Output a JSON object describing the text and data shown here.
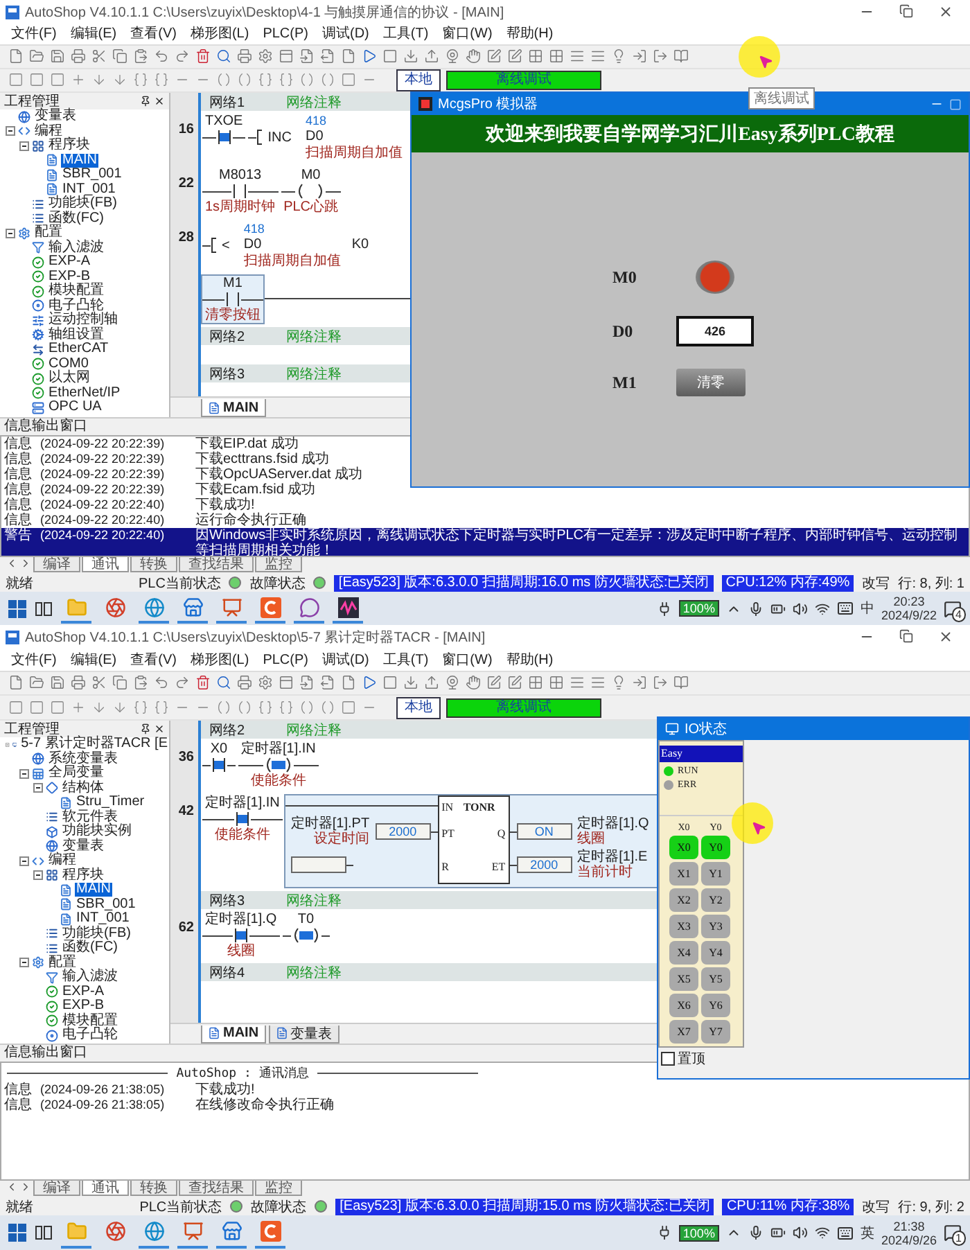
{
  "screens": [
    {
      "title": "AutoShop V4.10.1.1  C:\\Users\\zuyix\\Desktop\\4-1 与触摸屏通信的协议 - [MAIN]",
      "menu": [
        "文件(F)",
        "编辑(E)",
        "查看(V)",
        "梯形图(L)",
        "PLC(P)",
        "调试(D)",
        "工具(T)",
        "窗口(W)",
        "帮助(H)"
      ],
      "mode_button": "本地",
      "debug_status": "离线调试",
      "tooltip": "离线调试",
      "cursor": {
        "kind": "toolbar"
      },
      "project_panel": {
        "title": "工程管理",
        "tree": [
          {
            "label": "变量表",
            "kind": "globe",
            "selected": false
          },
          {
            "label": "编程",
            "kind": "code",
            "selected": false,
            "children": [
              {
                "label": "程序块",
                "kind": "blocks",
                "selected": false,
                "children": [
                  {
                    "label": "MAIN",
                    "kind": "page",
                    "selected": true
                  },
                  {
                    "label": "SBR_001",
                    "kind": "page",
                    "selected": false
                  },
                  {
                    "label": "INT_001",
                    "kind": "page",
                    "selected": false
                  }
                ]
              },
              {
                "label": "功能块(FB)",
                "kind": "list",
                "selected": false
              },
              {
                "label": "函数(FC)",
                "kind": "list",
                "selected": false
              }
            ]
          },
          {
            "label": "配置",
            "kind": "config",
            "selected": false,
            "children": [
              {
                "label": "输入滤波",
                "kind": "filter",
                "selected": false
              },
              {
                "label": "EXP-A",
                "kind": "check",
                "selected": false
              },
              {
                "label": "EXP-B",
                "kind": "check",
                "selected": false
              },
              {
                "label": "模块配置",
                "kind": "check",
                "selected": false
              },
              {
                "label": "电子凸轮",
                "kind": "cam",
                "selected": false
              },
              {
                "label": "运动控制轴",
                "kind": "axis",
                "selected": false
              },
              {
                "label": "轴组设置",
                "kind": "gear",
                "selected": false
              },
              {
                "label": "EtherCAT",
                "kind": "ethercat",
                "selected": false
              },
              {
                "label": "COM0",
                "kind": "check",
                "selected": false
              },
              {
                "label": "以太网",
                "kind": "check",
                "selected": false
              },
              {
                "label": "EtherNet/IP",
                "kind": "check",
                "selected": false
              },
              {
                "label": "OPC UA",
                "kind": "opc",
                "selected": false
              }
            ]
          }
        ]
      },
      "editor": {
        "networks": [
          {
            "label": "网络1",
            "comment": "网络注释",
            "rungs": [
              {
                "step": "16",
                "elements": [
                  {
                    "kind": "contact",
                    "operand": "TXOE",
                    "active": true,
                    "selected": false
                  },
                  {
                    "kind": "instr",
                    "op": "INC",
                    "selected": false,
                    "args": [
                      {
                        "value": "418",
                        "operand": "D0",
                        "comment": "扫描周期自加值"
                      }
                    ]
                  }
                ]
              },
              {
                "step": "22",
                "elements": [
                  {
                    "kind": "contact",
                    "operand": "M8013",
                    "comment": "1s周期时钟",
                    "active": false,
                    "selected": false
                  },
                  {
                    "kind": "coil",
                    "operand": "M0",
                    "comment": "PLC心跳",
                    "active": false,
                    "selected": false
                  }
                ]
              },
              {
                "step": "28",
                "elements": [
                  {
                    "kind": "instr",
                    "op": "<",
                    "selected": false,
                    "args": [
                      {
                        "value": "418",
                        "operand": "D0",
                        "comment": "扫描周期自加值"
                      },
                      {
                        "operand": "K0"
                      }
                    ]
                  }
                ]
              },
              {
                "elements": [
                  {
                    "kind": "contact",
                    "operand": "M1",
                    "comment": "清零按钮",
                    "active": false,
                    "selected": true
                  }
                ]
              }
            ]
          },
          {
            "label": "网络2",
            "comment": "网络注释"
          },
          {
            "label": "网络3",
            "comment": "网络注释"
          }
        ],
        "tabs": [
          {
            "label": "MAIN",
            "selected": true
          }
        ]
      },
      "output": {
        "title": "信息输出窗口",
        "lines": [
          {
            "level": "信息",
            "time": "(2024-09-22 20:22:39)",
            "message": "下载EIP.dat 成功",
            "selected": false
          },
          {
            "level": "信息",
            "time": "(2024-09-22 20:22:39)",
            "message": "下载ecttrans.fsid 成功",
            "selected": false
          },
          {
            "level": "信息",
            "time": "(2024-09-22 20:22:39)",
            "message": "下载OpcUAServer.dat 成功",
            "selected": false
          },
          {
            "level": "信息",
            "time": "(2024-09-22 20:22:39)",
            "message": "下载Ecam.fsid 成功",
            "selected": false
          },
          {
            "level": "信息",
            "time": "(2024-09-22 20:22:40)",
            "message": "下载成功!",
            "selected": false
          },
          {
            "level": "信息",
            "time": "(2024-09-22 20:22:40)",
            "message": "运行命令执行正确",
            "selected": false
          },
          {
            "level": "警告",
            "time": "(2024-09-22 20:22:40)",
            "message": "因Windows非实时系统原因，离线调试状态下定时器与实时PLC有一定差异：涉及定时中断子程序、内部时钟信号、运动控制等扫描周期相关功能！",
            "selected": true
          }
        ],
        "tabs": [
          {
            "label": "编译",
            "selected": false
          },
          {
            "label": "通讯",
            "selected": true
          },
          {
            "label": "转换",
            "selected": false
          },
          {
            "label": "查找结果",
            "selected": false
          },
          {
            "label": "监控",
            "selected": false
          }
        ]
      },
      "status_bar": {
        "ready": "就绪",
        "plc_state": {
          "label": "PLC当前状态",
          "on": true
        },
        "fault_state": {
          "label": "故障状态",
          "on": true
        },
        "info": "[Easy523] 版本:6.3.0.0 扫描周期:16.0 ms 防火墙状态:已关闭",
        "cpu": "CPU:12%  内存:49%",
        "mode": "改写",
        "position": "行:  8, 列:  1"
      },
      "taskbar": {
        "apps": [
          {
            "kind": "explorer",
            "running": true
          },
          {
            "kind": "tool",
            "running": false
          },
          {
            "kind": "edge",
            "running": true
          },
          {
            "kind": "store",
            "running": true
          },
          {
            "kind": "office",
            "running": true
          },
          {
            "kind": "autoshop",
            "running": true
          },
          {
            "kind": "chat",
            "running": true
          },
          {
            "kind": "sim",
            "running": true
          }
        ],
        "battery": "100%",
        "ime": "中",
        "time": "20:23",
        "date": "2024/9/22",
        "notifications": "4"
      },
      "window": {
        "kind": "simulator",
        "title": "McgsPro 模拟器",
        "banner": "欢迎来到我要自学网学习汇川Easy系列PLC教程",
        "rows": [
          {
            "label": "M0",
            "kind": "lamp",
            "on": true
          },
          {
            "label": "D0",
            "kind": "display",
            "value": "426"
          },
          {
            "label": "M1",
            "kind": "button",
            "text": "清零"
          }
        ]
      }
    },
    {
      "title": "AutoShop V4.10.1.1  C:\\Users\\zuyix\\Desktop\\5-7 累计定时器TACR - [MAIN]",
      "menu": [
        "文件(F)",
        "编辑(E)",
        "查看(V)",
        "梯形图(L)",
        "PLC(P)",
        "调试(D)",
        "工具(T)",
        "窗口(W)",
        "帮助(H)"
      ],
      "mode_button": "本地",
      "debug_status": "离线调试",
      "cursor": {
        "kind": "io"
      },
      "project_panel": {
        "title": "工程管理",
        "tree": [
          {
            "label": "5-7 累计定时器TACR [E",
            "kind": "pc",
            "selected": false,
            "children": [
              {
                "label": "系统变量表",
                "kind": "globe",
                "selected": false
              },
              {
                "label": "全局变量",
                "kind": "table",
                "selected": false,
                "children": [
                  {
                    "label": "结构体",
                    "kind": "struct",
                    "selected": false,
                    "children": [
                      {
                        "label": "Stru_Timer",
                        "kind": "page",
                        "selected": false
                      }
                    ]
                  },
                  {
                    "label": "软元件表",
                    "kind": "list",
                    "selected": false
                  },
                  {
                    "label": "功能块实例",
                    "kind": "box",
                    "selected": false
                  },
                  {
                    "label": "变量表",
                    "kind": "globe",
                    "selected": false
                  }
                ]
              },
              {
                "label": "编程",
                "kind": "code",
                "selected": false,
                "children": [
                  {
                    "label": "程序块",
                    "kind": "blocks",
                    "selected": false,
                    "children": [
                      {
                        "label": "MAIN",
                        "kind": "page",
                        "selected": true
                      },
                      {
                        "label": "SBR_001",
                        "kind": "page",
                        "selected": false
                      },
                      {
                        "label": "INT_001",
                        "kind": "page",
                        "selected": false
                      }
                    ]
                  },
                  {
                    "label": "功能块(FB)",
                    "kind": "list",
                    "selected": false
                  },
                  {
                    "label": "函数(FC)",
                    "kind": "list",
                    "selected": false
                  }
                ]
              },
              {
                "label": "配置",
                "kind": "config",
                "selected": false,
                "children": [
                  {
                    "label": "输入滤波",
                    "kind": "filter",
                    "selected": false
                  },
                  {
                    "label": "EXP-A",
                    "kind": "check",
                    "selected": false
                  },
                  {
                    "label": "EXP-B",
                    "kind": "check",
                    "selected": false
                  },
                  {
                    "label": "模块配置",
                    "kind": "check",
                    "selected": false
                  },
                  {
                    "label": "电子凸轮",
                    "kind": "cam",
                    "selected": false
                  }
                ]
              }
            ]
          }
        ]
      },
      "editor": {
        "networks": [
          {
            "label": "网络2",
            "comment": "网络注释",
            "rungs": [
              {
                "step": "36",
                "elements": [
                  {
                    "kind": "contact",
                    "operand": "X0",
                    "active": true,
                    "selected": false
                  },
                  {
                    "kind": "coil",
                    "operand": "定时器[1].IN",
                    "comment": "使能条件",
                    "active": true,
                    "selected": false
                  }
                ]
              },
              {
                "step": "42",
                "elements": [
                  {
                    "kind": "contact",
                    "operand": "定时器[1].IN",
                    "comment": "使能条件",
                    "active": true,
                    "selected": false
                  },
                  {
                    "kind": "block",
                    "type": "TONR",
                    "selected": true,
                    "inputs": [
                      {
                        "pin": "IN"
                      },
                      {
                        "pin": "PT",
                        "operand": "定时器[1].PT",
                        "value": "2000",
                        "comment": "设定时间"
                      },
                      {
                        "pin": "R"
                      }
                    ],
                    "outputs": [
                      {
                        "pin": "Q",
                        "value": "ON",
                        "operand": "定时器[1].Q",
                        "comment": "线圈"
                      },
                      {
                        "pin": "ET",
                        "value": "2000",
                        "operand": "定时器[1].E",
                        "comment": "当前计时"
                      }
                    ]
                  }
                ]
              }
            ]
          },
          {
            "label": "网络3",
            "comment": "网络注释",
            "rungs": [
              {
                "step": "62",
                "elements": [
                  {
                    "kind": "contact",
                    "operand": "定时器[1].Q",
                    "comment": "线圈",
                    "active": true,
                    "selected": false
                  },
                  {
                    "kind": "coil",
                    "operand": "T0",
                    "active": true,
                    "selected": false
                  }
                ]
              }
            ]
          },
          {
            "label": "网络4",
            "comment": "网络注释"
          }
        ],
        "tabs": [
          {
            "label": "MAIN",
            "selected": true
          },
          {
            "label": "变量表",
            "selected": false
          }
        ]
      },
      "output": {
        "title": "信息输出窗口",
        "header": "AutoShop : 通讯消息",
        "lines": [
          {
            "level": "信息",
            "time": "(2024-09-26 21:38:05)",
            "message": "下载成功!",
            "selected": false
          },
          {
            "level": "信息",
            "time": "(2024-09-26 21:38:05)",
            "message": "在线修改命令执行正确",
            "selected": false
          }
        ],
        "tabs": [
          {
            "label": "编译",
            "selected": false
          },
          {
            "label": "通讯",
            "selected": true
          },
          {
            "label": "转换",
            "selected": false
          },
          {
            "label": "查找结果",
            "selected": false
          },
          {
            "label": "监控",
            "selected": false
          }
        ]
      },
      "status_bar": {
        "ready": "就绪",
        "plc_state": {
          "label": "PLC当前状态",
          "on": true
        },
        "fault_state": {
          "label": "故障状态",
          "on": true
        },
        "info": "[Easy523] 版本:6.3.0.0 扫描周期:15.0 ms 防火墙状态:已关闭",
        "cpu": "CPU:11%  内存:38%",
        "mode": "改写",
        "position": "行:  9, 列:  2"
      },
      "taskbar": {
        "apps": [
          {
            "kind": "explorer",
            "running": true
          },
          {
            "kind": "tool",
            "running": false
          },
          {
            "kind": "edge",
            "running": true
          },
          {
            "kind": "office",
            "running": true
          },
          {
            "kind": "store",
            "running": true
          },
          {
            "kind": "autoshop",
            "running": true
          }
        ],
        "battery": "100%",
        "ime": "英",
        "time": "21:38",
        "date": "2024/9/26",
        "notifications": "1"
      },
      "window": {
        "kind": "io",
        "title": "IO状态",
        "device": "Easy",
        "leds": [
          {
            "label": "RUN",
            "on": true
          },
          {
            "label": "ERR",
            "on": false
          }
        ],
        "columns": [
          "X0",
          "Y0"
        ],
        "points": [
          [
            {
              "label": "X0",
              "on": true
            },
            {
              "label": "Y0",
              "on": true
            }
          ],
          [
            {
              "label": "X1",
              "on": false
            },
            {
              "label": "Y1",
              "on": false
            }
          ],
          [
            {
              "label": "X2",
              "on": false
            },
            {
              "label": "Y2",
              "on": false
            }
          ],
          [
            {
              "label": "X3",
              "on": false
            },
            {
              "label": "Y3",
              "on": false
            }
          ],
          [
            {
              "label": "X4",
              "on": false
            },
            {
              "label": "Y4",
              "on": false
            }
          ],
          [
            {
              "label": "X5",
              "on": false
            },
            {
              "label": "Y5",
              "on": false
            }
          ],
          [
            {
              "label": "X6",
              "on": false
            },
            {
              "label": "Y6",
              "on": false
            }
          ],
          [
            {
              "label": "X7",
              "on": false
            },
            {
              "label": "Y7",
              "on": false
            }
          ]
        ],
        "pin_on_top": {
          "label": "置顶",
          "checked": false
        }
      }
    }
  ]
}
